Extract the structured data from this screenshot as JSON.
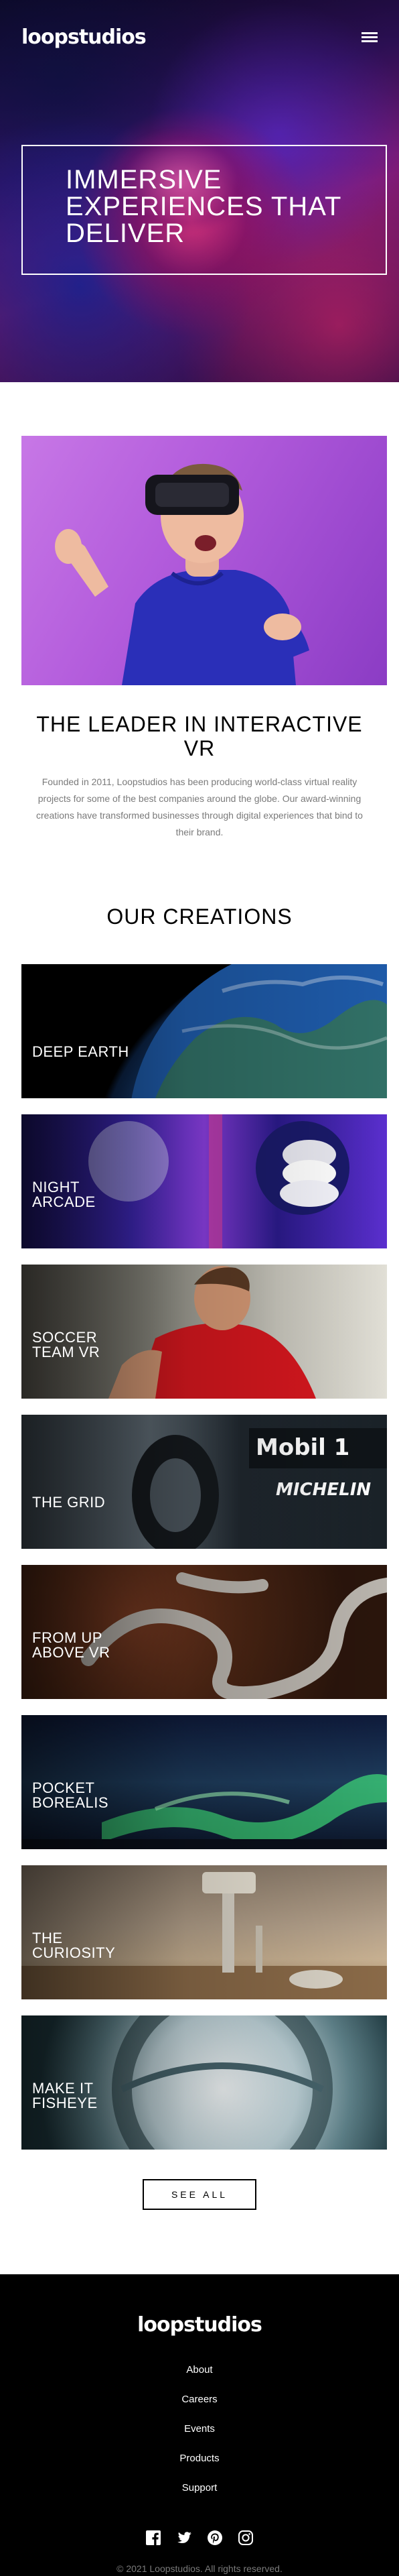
{
  "header": {
    "logo": "loopstudios",
    "menu_icon": "hamburger-menu-icon"
  },
  "hero": {
    "title": "Immersive experiences that deliver"
  },
  "about": {
    "title": "The leader in interactive VR",
    "text": "Founded in 2011, Loopstudios has been producing world-class virtual reality projects for some of the best companies around the globe. Our award-winning creations have transformed businesses through digital experiences that bind to their brand."
  },
  "creations": {
    "title": "Our creations",
    "items": [
      {
        "label": "Deep Earth"
      },
      {
        "label": "Night Arcade"
      },
      {
        "label": "Soccer Team VR"
      },
      {
        "label": "The Grid"
      },
      {
        "label": "From Up Above VR"
      },
      {
        "label": "Pocket Borealis"
      },
      {
        "label": "The Curiosity"
      },
      {
        "label": "Make It Fisheye"
      }
    ],
    "see_all": "See all"
  },
  "footer": {
    "logo": "loopstudios",
    "nav": [
      "About",
      "Careers",
      "Events",
      "Products",
      "Support"
    ],
    "socials": [
      "facebook-icon",
      "twitter-icon",
      "pinterest-icon",
      "instagram-icon"
    ],
    "copyright": "© 2021 Loopstudios. All rights reserved."
  },
  "colors": {
    "black": "#000000",
    "white": "#ffffff",
    "dark_gray": "#7a7a7a"
  }
}
